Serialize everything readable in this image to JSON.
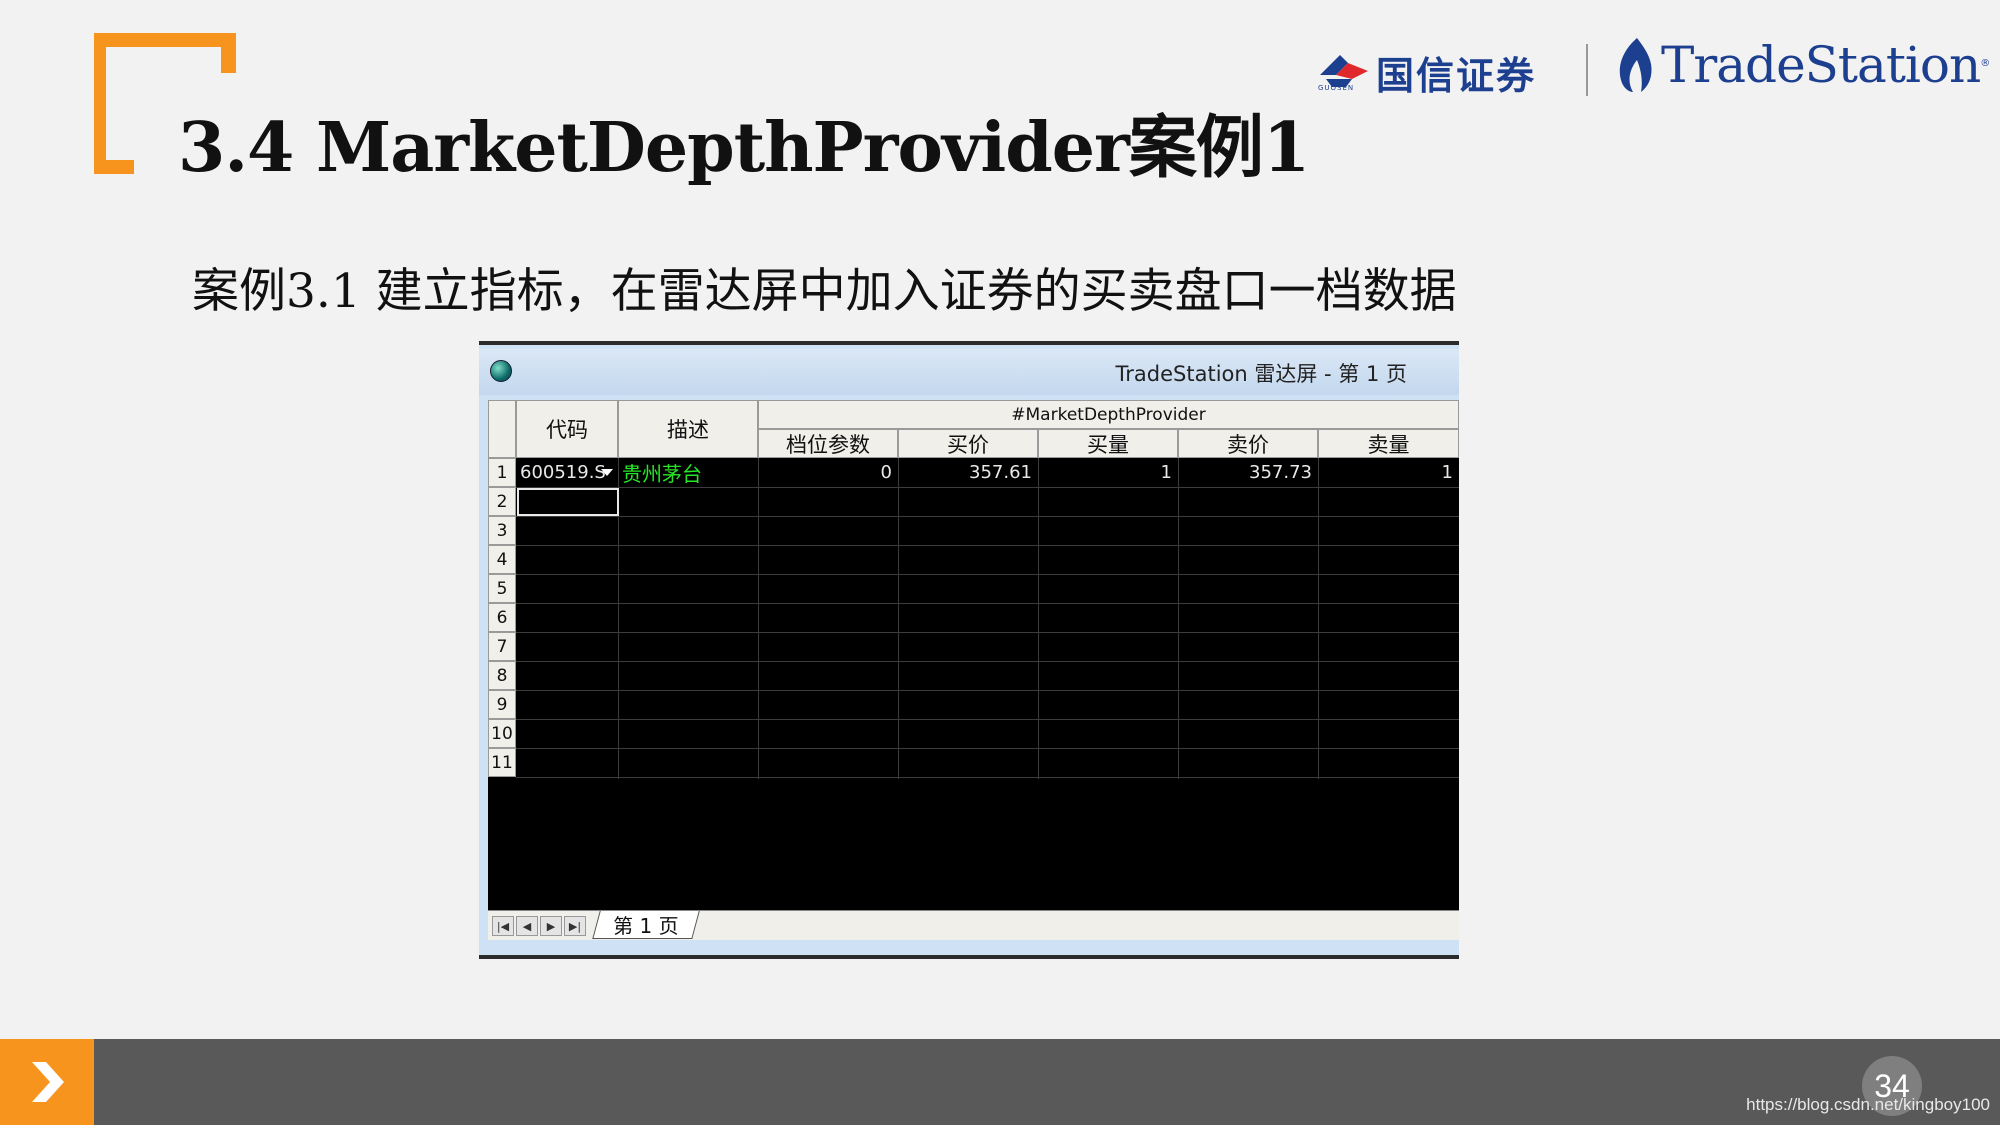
{
  "slide": {
    "title": "3.4 MarketDepthProvider案例1",
    "subtitle": "案例3.1 建立指标，在雷达屏中加入证券的买卖盘口一档数据",
    "page_number": "34",
    "watermark": "https://blog.csdn.net/kingboy100",
    "accent_color": "#f7941d"
  },
  "logos": {
    "guosen_name": "国信证券",
    "guosen_sub": "GUOSEN",
    "tradestation_name": "TradeStation",
    "tradestation_reg": "®"
  },
  "window": {
    "title": "TradeStation 雷达屏 - 第 1 页",
    "icon": "tradestation-globe-icon",
    "columns": {
      "symbol": "代码",
      "description": "描述",
      "group": "#MarketDepthProvider",
      "level_param": "档位参数",
      "bid_price": "买价",
      "bid_size": "买量",
      "ask_price": "卖价",
      "ask_size": "卖量"
    },
    "row_numbers": [
      "1",
      "2",
      "3",
      "4",
      "5",
      "6",
      "7",
      "8",
      "9",
      "10",
      "11"
    ],
    "rows": [
      {
        "symbol": "600519.S",
        "description": "贵州茅台",
        "level_param": "0",
        "bid_price": "357.61",
        "bid_size": "1",
        "ask_price": "357.73",
        "ask_size": "1"
      }
    ],
    "sheet_tab": "第 1 页",
    "nav_buttons": [
      "first-page-icon",
      "prev-page-icon",
      "next-page-icon",
      "last-page-icon"
    ]
  }
}
